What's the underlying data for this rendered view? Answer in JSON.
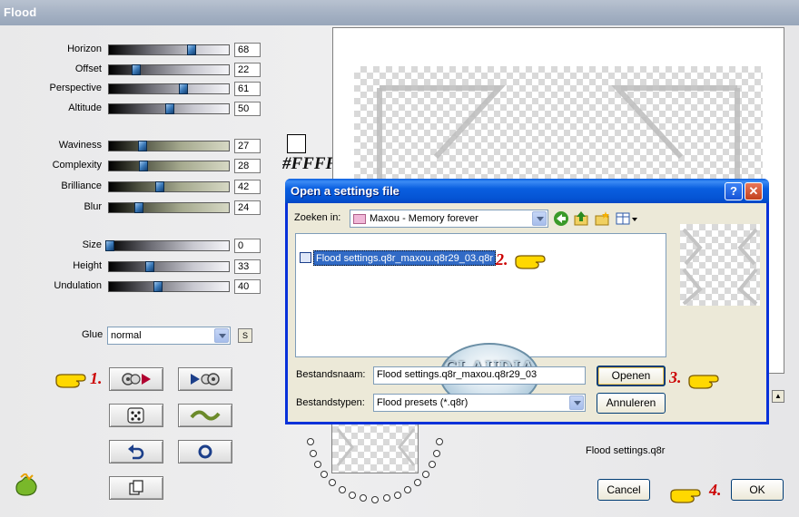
{
  "window": {
    "title": "Flood"
  },
  "sliders": [
    {
      "id": "horizon",
      "label": "Horizon",
      "value": "68",
      "track": "gray"
    },
    {
      "id": "offset",
      "label": "Offset",
      "value": "22",
      "track": "gray"
    },
    {
      "id": "perspective",
      "label": "Perspective",
      "value": "61",
      "track": "gray"
    },
    {
      "id": "altitude",
      "label": "Altitude",
      "value": "50",
      "track": "gray"
    },
    {
      "id": "waviness",
      "label": "Waviness",
      "value": "27",
      "track": "olive"
    },
    {
      "id": "complexity",
      "label": "Complexity",
      "value": "28",
      "track": "olive"
    },
    {
      "id": "brilliance",
      "label": "Brilliance",
      "value": "42",
      "track": "olive"
    },
    {
      "id": "blur",
      "label": "Blur",
      "value": "24",
      "track": "olive"
    },
    {
      "id": "size",
      "label": "Size",
      "value": "0",
      "track": "gray"
    },
    {
      "id": "height",
      "label": "Height",
      "value": "33",
      "track": "gray"
    },
    {
      "id": "undulation",
      "label": "Undulation",
      "value": "40",
      "track": "gray"
    }
  ],
  "glue": {
    "label": "Glue",
    "value": "normal",
    "s_label": "S"
  },
  "color": {
    "hex": "#FFFFFF"
  },
  "steps": [
    "1.",
    "2.",
    "3.",
    "4."
  ],
  "bottom": {
    "settings_name": "Flood settings.q8r",
    "cancel_label": "Cancel",
    "ok_label": "OK"
  },
  "dialog": {
    "title": "Open a settings file",
    "help_label": "?",
    "close_label": "✕",
    "look_in_label": "Zoeken in:",
    "look_in_value": "Maxou - Memory forever",
    "file_item": "Flood settings.q8r_maxou.q8r29_03.q8r",
    "watermark": "CLAUDIA",
    "filename_label": "Bestandsnaam:",
    "filename_value": "Flood settings.q8r_maxou.q8r29_03",
    "filetype_label": "Bestandstypen:",
    "filetype_value": "Flood presets (*.q8r)",
    "open_label": "Openen",
    "cancel_label": "Annuleren"
  },
  "icons": {
    "back": "back-arrow-icon",
    "up": "up-folder-icon",
    "newfolder": "new-folder-icon",
    "view": "view-menu-icon"
  }
}
